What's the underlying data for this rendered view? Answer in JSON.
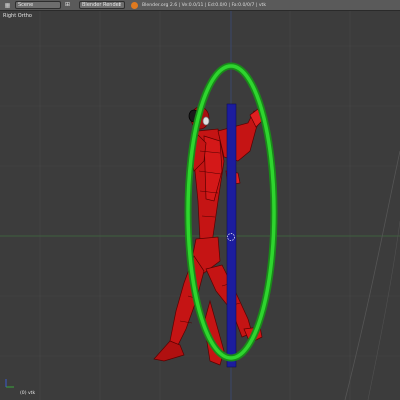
{
  "header": {
    "editor_icon": "3d-view-icon",
    "scene_field": "Scene",
    "engine_select": "Blender Render",
    "stats": "Blender.org 2.6 | Ve:0.0/11 | Ed:0.0/0 | Fa:0.0/0/7 | vtk"
  },
  "viewport": {
    "view_label": "Right Ortho",
    "object_label": "(0) vtk"
  },
  "colors": {
    "background": "#3c3c3c",
    "grid": "#4a4a4a",
    "ring": "#1fc21f",
    "bar": "#1a1a9a",
    "figure": "#c21212"
  }
}
